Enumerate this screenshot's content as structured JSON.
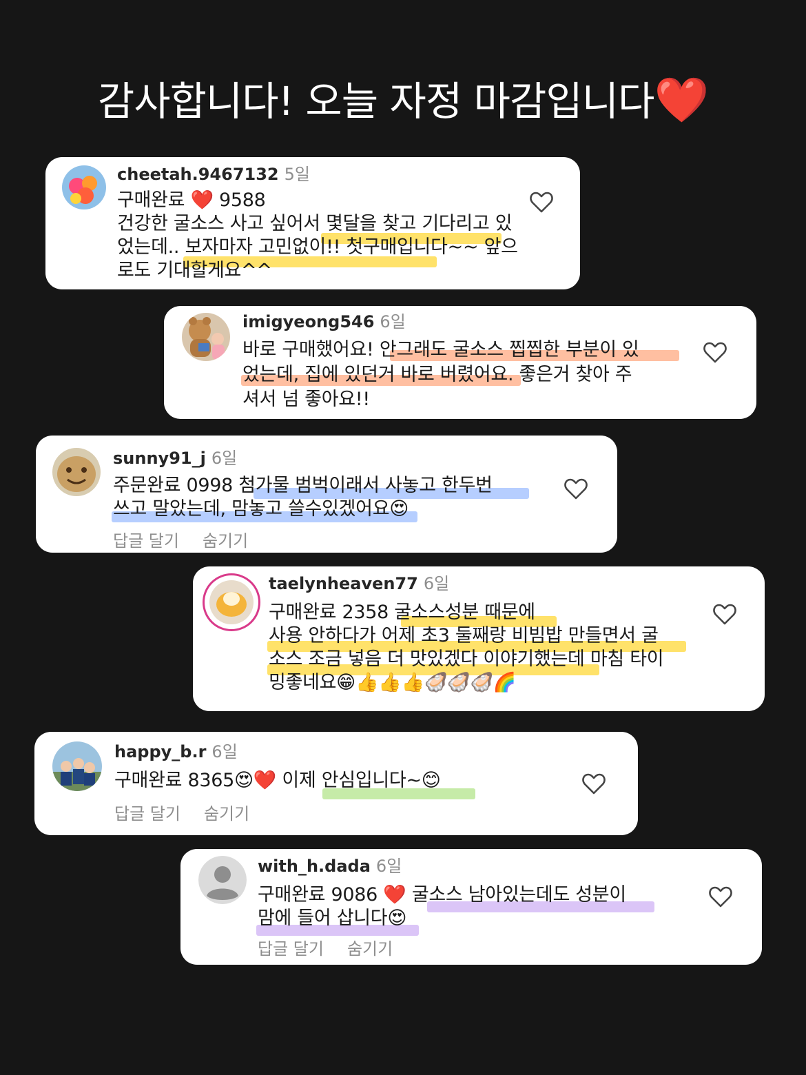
{
  "headline": {
    "text": "감사합니다! 오늘 자정 마감입니다",
    "heart": "❤️"
  },
  "comments": [
    {
      "username": "cheetah.9467132",
      "time": "5일",
      "body": "구매완료 ❤️ 9588\n건강한 굴소스 사고 싶어서 몇달을 찾고 기다리고 있\n었는데.. 보자마자 고민없이!! 첫구매입니다~~ 앞으\n로도 기대할게요^^",
      "actions": []
    },
    {
      "username": "imigyeong546",
      "time": "6일",
      "body": "바로 구매했어요! 안그래도 굴소스 찝찝한 부분이 있\n었는데, 집에 있던거 바로 버렸어요. 좋은거 찾아 주\n셔서 넘 좋아요!!",
      "actions": []
    },
    {
      "username": "sunny91_j",
      "time": "6일",
      "body": "주문완료 0998 첨가물 범벅이래서 사놓고 한두번\n쓰고 말았는데, 맘놓고 쓸수있겠어요😍",
      "actions": [
        "답글 달기",
        "숨기기"
      ]
    },
    {
      "username": "taelynheaven77",
      "time": "6일",
      "body": "구매완료 2358 굴소스성분 때문에\n사용 안하다가 어제 초3 둘째랑 비빔밥 만들면서 굴\n소스 조금 넣음 더 맛있겠다 이야기했는데 마침 타이\n밍좋네요😁👍👍👍🦪🦪🦪🌈",
      "actions": []
    },
    {
      "username": "happy_b.r",
      "time": "6일",
      "body": "구매완료 8365😍❤️ 이제 안심입니다~😊",
      "actions": [
        "답글 달기",
        "숨기기"
      ]
    },
    {
      "username": "with_h.dada",
      "time": "6일",
      "body": "구매완료 9086 ❤️ 굴소스 남아있는데도 성분이\n맘에 들어 삽니다😍",
      "actions": [
        "답글 달기",
        "숨기기"
      ]
    }
  ],
  "icons": {
    "like": "heart-outline-icon",
    "default_avatar": "person-silhouette-icon"
  },
  "colors": {
    "background": "#161616",
    "card": "#ffffff",
    "highlight_yellow": "#ffd21a",
    "highlight_orange": "#ff9c6e",
    "highlight_blue": "#8fb3ff",
    "highlight_green": "#a8e07a",
    "highlight_purple": "#c7a6f2",
    "heart": "#e0141b"
  }
}
